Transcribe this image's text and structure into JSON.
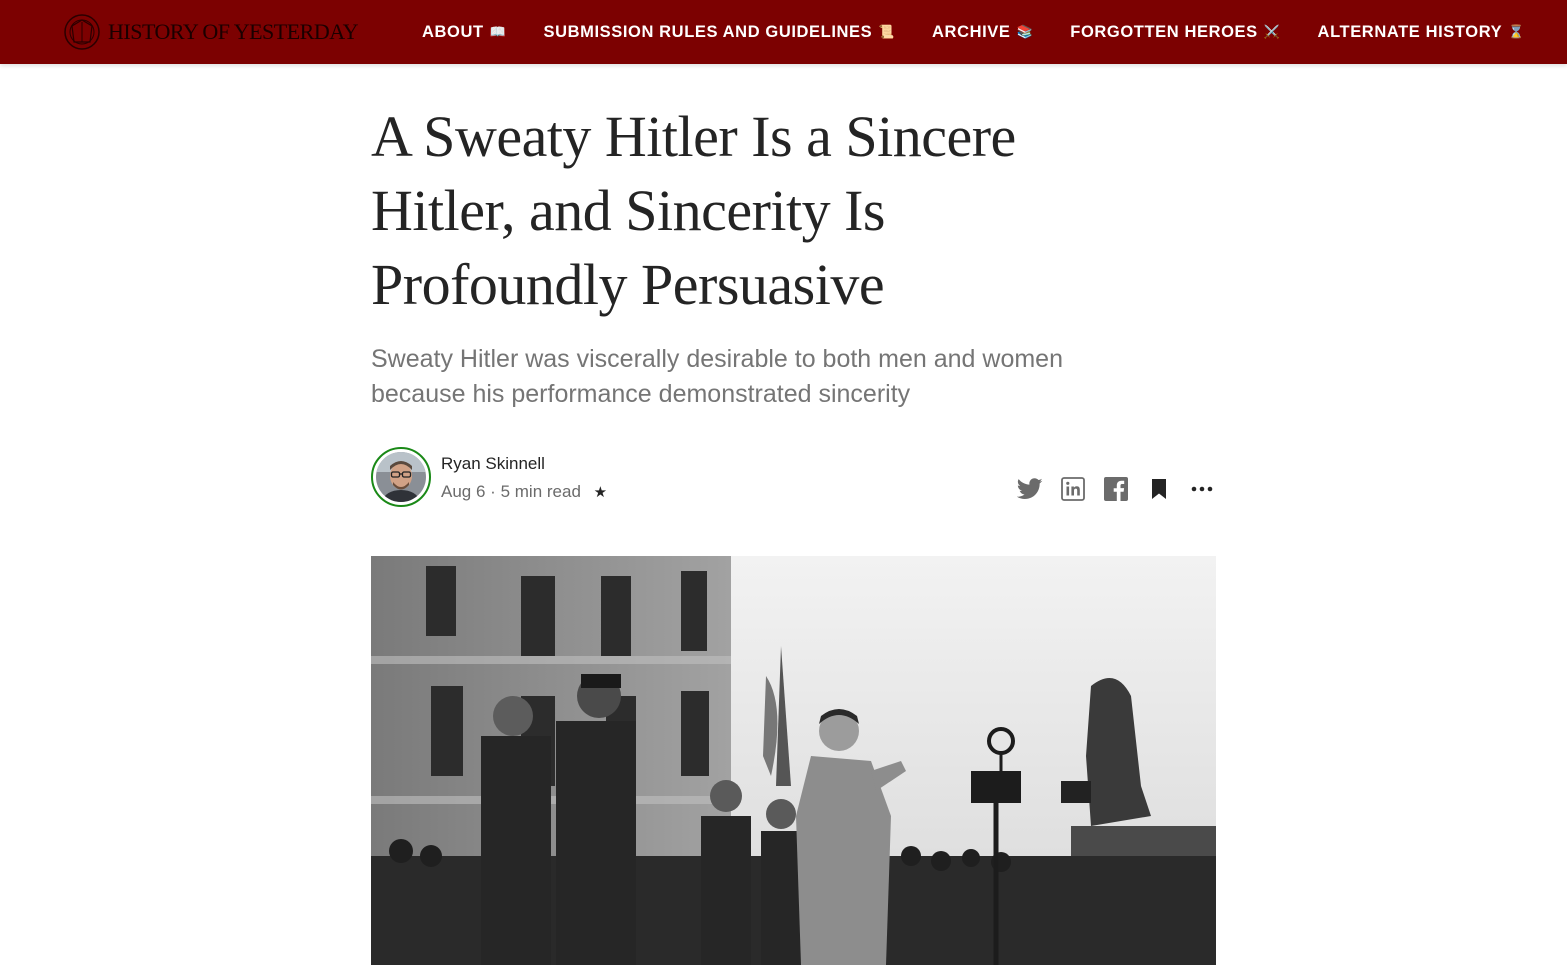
{
  "site": {
    "logo_text": "HISTORY OF YESTERDAY",
    "nav": [
      {
        "label": "ABOUT",
        "emoji": "📖"
      },
      {
        "label": "SUBMISSION RULES AND GUIDELINES",
        "emoji": "📜"
      },
      {
        "label": "ARCHIVE",
        "emoji": "📚"
      },
      {
        "label": "FORGOTTEN HEROES",
        "emoji": "⚔️"
      },
      {
        "label": "ALTERNATE HISTORY",
        "emoji": "⌛"
      }
    ],
    "colors": {
      "brand": "#7c0101",
      "title": "#242424",
      "subtitle": "#757575",
      "ring": "#1a8917"
    }
  },
  "article": {
    "title": "A Sweaty Hitler Is a Sincere Hitler, and Sincerity Is Profoundly Persuasive",
    "subtitle": "Sweaty Hitler was viscerally desirable to both men and women because his performance demonstrated sincerity",
    "author": "Ryan Skinnell",
    "date": "Aug 6",
    "separator": "·",
    "read_time": "5 min read",
    "member_star": "★",
    "actions": [
      "twitter-icon",
      "linkedin-icon",
      "facebook-icon",
      "bookmark-icon",
      "more-icon"
    ]
  }
}
